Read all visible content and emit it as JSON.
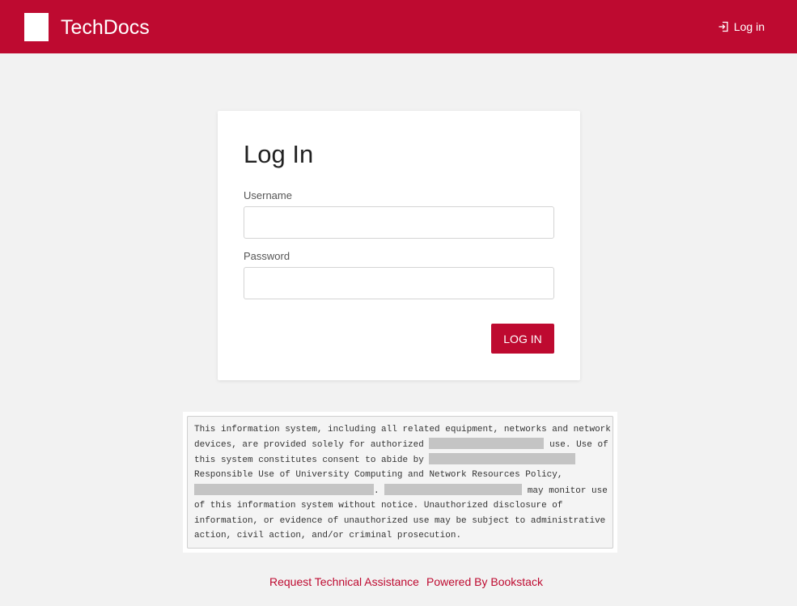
{
  "header": {
    "site_name": "TechDocs",
    "login_label": "Log in",
    "login_icon": "login-icon",
    "brand_color": "#be0a30"
  },
  "login_form": {
    "title": "Log In",
    "username_label": "Username",
    "username_value": "",
    "password_label": "Password",
    "password_value": "",
    "submit_label": "LOG IN"
  },
  "notice": {
    "line1": "This information system, including all related equipment, networks and network",
    "line2a": "devices, are provided solely for authorized",
    "line2b": "use. Use of",
    "line3a": "this system constitutes consent to abide by",
    "line4": "Responsible Use of University Computing and Network Resources Policy,",
    "line5a": ".",
    "line5b": "may monitor use",
    "line6": "of this information system without notice. Unauthorized disclosure of",
    "line7": "information, or evidence of unauthorized use may be subject to administrative",
    "line8": "action, civil action, and/or criminal prosecution."
  },
  "footer": {
    "assistance_label": "Request Technical Assistance",
    "powered_label": "Powered By Bookstack"
  }
}
